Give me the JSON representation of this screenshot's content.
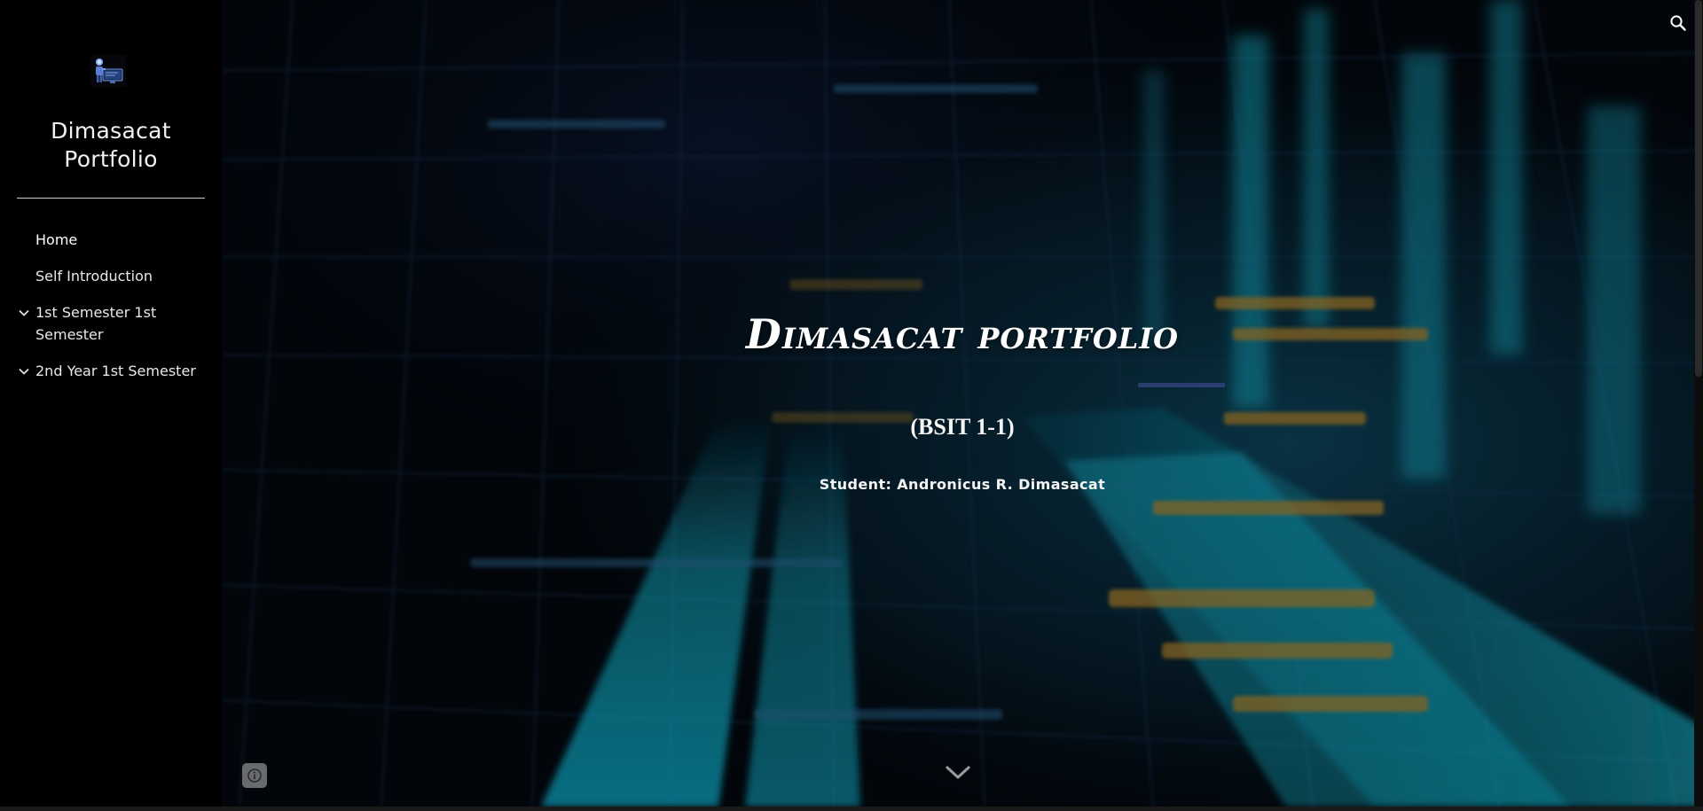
{
  "sidebar": {
    "logo_icon": "robot-at-computer-icon",
    "site_title": "Dimasacat Portfolio",
    "nav_items": [
      {
        "label": "Home",
        "expandable": false,
        "active": true
      },
      {
        "label": "Self Introduction",
        "expandable": false,
        "active": false
      },
      {
        "label": "1st Semester 1st Semester",
        "expandable": true,
        "active": false
      },
      {
        "label": "2nd Year 1st Semester",
        "expandable": true,
        "active": false
      }
    ]
  },
  "hero": {
    "title": "Dimasacat portfolio",
    "subtitle": "(BSIT 1-1)",
    "student": "Student: Andronicus R. Dimasacat",
    "background": "blurred-cyan-digital-grid-with-code",
    "accent_color": "#2a3f6f"
  },
  "controls": {
    "search_icon": "search-icon",
    "scroll_icon": "chevron-down-icon",
    "info_icon": "info-icon"
  }
}
